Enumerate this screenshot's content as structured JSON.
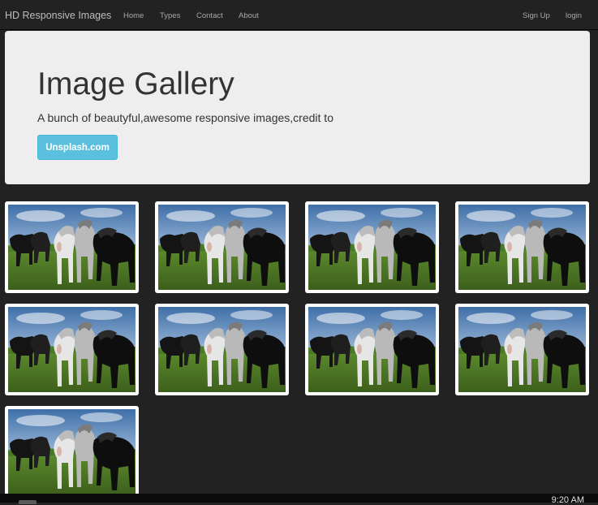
{
  "navbar": {
    "brand": "HD Responsive Images",
    "links": [
      "Home",
      "Types",
      "Contact",
      "About"
    ],
    "right_links": [
      "Sign Up",
      "login"
    ]
  },
  "jumbotron": {
    "title": "Image Gallery",
    "text": "A bunch of beautyful,awesome responsive images,credit to",
    "button_label": "Unsplash.com"
  },
  "gallery": {
    "image_count": 9,
    "image_subject": "horses-photo"
  },
  "taskbar": {
    "clock": "9:20 AM"
  },
  "colors": {
    "background": "#222222",
    "jumbotron": "#eeeeee",
    "button": "#5bc0de"
  }
}
